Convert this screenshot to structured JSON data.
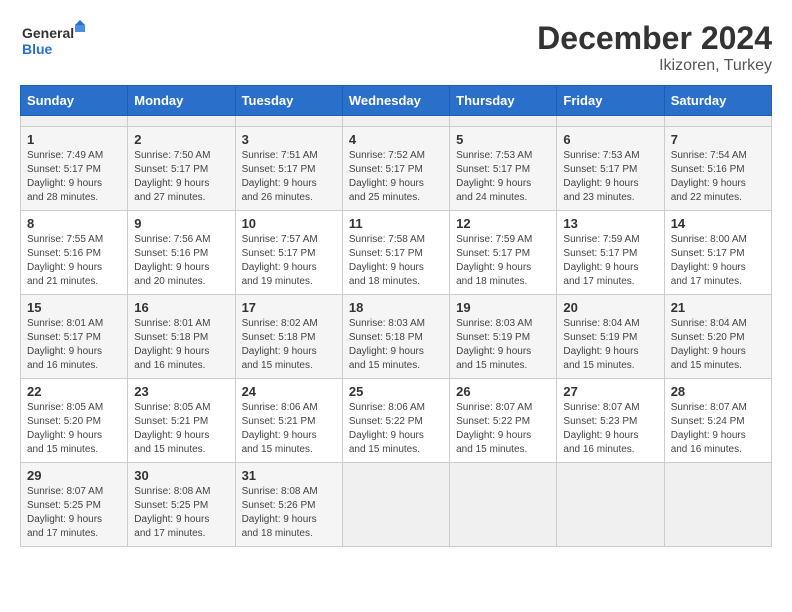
{
  "header": {
    "logo_line1": "General",
    "logo_line2": "Blue",
    "title": "December 2024",
    "subtitle": "Ikizoren, Turkey"
  },
  "calendar": {
    "days_of_week": [
      "Sunday",
      "Monday",
      "Tuesday",
      "Wednesday",
      "Thursday",
      "Friday",
      "Saturday"
    ],
    "weeks": [
      [
        {
          "day": "",
          "info": ""
        },
        {
          "day": "",
          "info": ""
        },
        {
          "day": "",
          "info": ""
        },
        {
          "day": "",
          "info": ""
        },
        {
          "day": "",
          "info": ""
        },
        {
          "day": "",
          "info": ""
        },
        {
          "day": "",
          "info": ""
        }
      ],
      [
        {
          "day": "1",
          "info": "Sunrise: 7:49 AM\nSunset: 5:17 PM\nDaylight: 9 hours and 28 minutes."
        },
        {
          "day": "2",
          "info": "Sunrise: 7:50 AM\nSunset: 5:17 PM\nDaylight: 9 hours and 27 minutes."
        },
        {
          "day": "3",
          "info": "Sunrise: 7:51 AM\nSunset: 5:17 PM\nDaylight: 9 hours and 26 minutes."
        },
        {
          "day": "4",
          "info": "Sunrise: 7:52 AM\nSunset: 5:17 PM\nDaylight: 9 hours and 25 minutes."
        },
        {
          "day": "5",
          "info": "Sunrise: 7:53 AM\nSunset: 5:17 PM\nDaylight: 9 hours and 24 minutes."
        },
        {
          "day": "6",
          "info": "Sunrise: 7:53 AM\nSunset: 5:17 PM\nDaylight: 9 hours and 23 minutes."
        },
        {
          "day": "7",
          "info": "Sunrise: 7:54 AM\nSunset: 5:16 PM\nDaylight: 9 hours and 22 minutes."
        }
      ],
      [
        {
          "day": "8",
          "info": "Sunrise: 7:55 AM\nSunset: 5:16 PM\nDaylight: 9 hours and 21 minutes."
        },
        {
          "day": "9",
          "info": "Sunrise: 7:56 AM\nSunset: 5:16 PM\nDaylight: 9 hours and 20 minutes."
        },
        {
          "day": "10",
          "info": "Sunrise: 7:57 AM\nSunset: 5:17 PM\nDaylight: 9 hours and 19 minutes."
        },
        {
          "day": "11",
          "info": "Sunrise: 7:58 AM\nSunset: 5:17 PM\nDaylight: 9 hours and 18 minutes."
        },
        {
          "day": "12",
          "info": "Sunrise: 7:59 AM\nSunset: 5:17 PM\nDaylight: 9 hours and 18 minutes."
        },
        {
          "day": "13",
          "info": "Sunrise: 7:59 AM\nSunset: 5:17 PM\nDaylight: 9 hours and 17 minutes."
        },
        {
          "day": "14",
          "info": "Sunrise: 8:00 AM\nSunset: 5:17 PM\nDaylight: 9 hours and 17 minutes."
        }
      ],
      [
        {
          "day": "15",
          "info": "Sunrise: 8:01 AM\nSunset: 5:17 PM\nDaylight: 9 hours and 16 minutes."
        },
        {
          "day": "16",
          "info": "Sunrise: 8:01 AM\nSunset: 5:18 PM\nDaylight: 9 hours and 16 minutes."
        },
        {
          "day": "17",
          "info": "Sunrise: 8:02 AM\nSunset: 5:18 PM\nDaylight: 9 hours and 15 minutes."
        },
        {
          "day": "18",
          "info": "Sunrise: 8:03 AM\nSunset: 5:18 PM\nDaylight: 9 hours and 15 minutes."
        },
        {
          "day": "19",
          "info": "Sunrise: 8:03 AM\nSunset: 5:19 PM\nDaylight: 9 hours and 15 minutes."
        },
        {
          "day": "20",
          "info": "Sunrise: 8:04 AM\nSunset: 5:19 PM\nDaylight: 9 hours and 15 minutes."
        },
        {
          "day": "21",
          "info": "Sunrise: 8:04 AM\nSunset: 5:20 PM\nDaylight: 9 hours and 15 minutes."
        }
      ],
      [
        {
          "day": "22",
          "info": "Sunrise: 8:05 AM\nSunset: 5:20 PM\nDaylight: 9 hours and 15 minutes."
        },
        {
          "day": "23",
          "info": "Sunrise: 8:05 AM\nSunset: 5:21 PM\nDaylight: 9 hours and 15 minutes."
        },
        {
          "day": "24",
          "info": "Sunrise: 8:06 AM\nSunset: 5:21 PM\nDaylight: 9 hours and 15 minutes."
        },
        {
          "day": "25",
          "info": "Sunrise: 8:06 AM\nSunset: 5:22 PM\nDaylight: 9 hours and 15 minutes."
        },
        {
          "day": "26",
          "info": "Sunrise: 8:07 AM\nSunset: 5:22 PM\nDaylight: 9 hours and 15 minutes."
        },
        {
          "day": "27",
          "info": "Sunrise: 8:07 AM\nSunset: 5:23 PM\nDaylight: 9 hours and 16 minutes."
        },
        {
          "day": "28",
          "info": "Sunrise: 8:07 AM\nSunset: 5:24 PM\nDaylight: 9 hours and 16 minutes."
        }
      ],
      [
        {
          "day": "29",
          "info": "Sunrise: 8:07 AM\nSunset: 5:25 PM\nDaylight: 9 hours and 17 minutes."
        },
        {
          "day": "30",
          "info": "Sunrise: 8:08 AM\nSunset: 5:25 PM\nDaylight: 9 hours and 17 minutes."
        },
        {
          "day": "31",
          "info": "Sunrise: 8:08 AM\nSunset: 5:26 PM\nDaylight: 9 hours and 18 minutes."
        },
        {
          "day": "",
          "info": ""
        },
        {
          "day": "",
          "info": ""
        },
        {
          "day": "",
          "info": ""
        },
        {
          "day": "",
          "info": ""
        }
      ]
    ]
  }
}
